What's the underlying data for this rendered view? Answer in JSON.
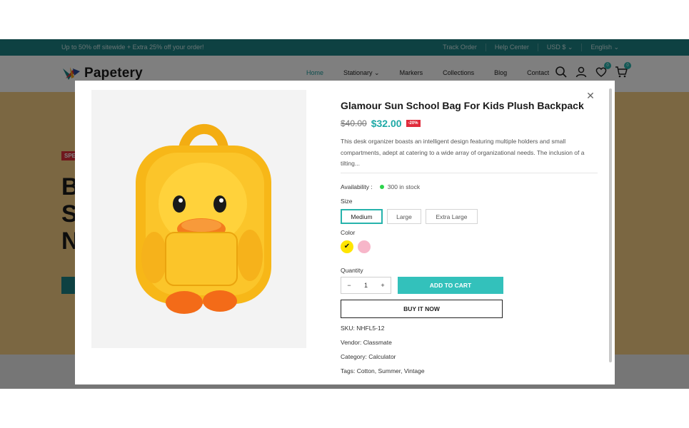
{
  "topbar": {
    "promo": "Up to 50% off sitewide + Extra 25% off your order!",
    "links": [
      "Track Order",
      "Help Center",
      "USD $ ⌄",
      "English ⌄"
    ]
  },
  "header": {
    "logo_text": "Papetery",
    "nav": [
      "Home",
      "Stationary ⌄",
      "Markers",
      "Collections",
      "Blog",
      "Contact"
    ],
    "wishlist_count": "0",
    "cart_count": "0"
  },
  "hero": {
    "tag": "SPE",
    "lines": [
      "B",
      "S",
      "N"
    ]
  },
  "product": {
    "title": "Glamour Sun School Bag For Kids Plush Backpack",
    "old_price": "$40.00",
    "new_price": "$32.00",
    "discount": "-20%",
    "description": "This desk organizer boasts an intelligent design featuring multiple holders and small compartments, adept at catering to a wide array of organizational needs. The inclusion of a tilting...",
    "availability_label": "Availability :",
    "stock_text": "300 in stock",
    "size_label": "Size",
    "sizes": [
      "Medium",
      "Large",
      "Extra Large"
    ],
    "selected_size": "Medium",
    "color_label": "Color",
    "colors": [
      "#ffe500",
      "#f7b6c9"
    ],
    "quantity_label": "Quantity",
    "quantity": "1",
    "minus": "−",
    "plus": "+",
    "add_to_cart": "ADD TO CART",
    "buy_now": "BUY IT NOW",
    "sku_label": "SKU:",
    "sku": "NHFL5-12",
    "vendor_label": "Vendor:",
    "vendor": "Classmate",
    "category_label": "Category:",
    "category": "Calculator",
    "tags_label": "Tags:",
    "tags": [
      "Cotton",
      "Summer",
      "Vintage"
    ]
  },
  "colors": {
    "accent": "#33c1bb",
    "topbar": "#1d8385",
    "discount": "#e02b3b"
  }
}
